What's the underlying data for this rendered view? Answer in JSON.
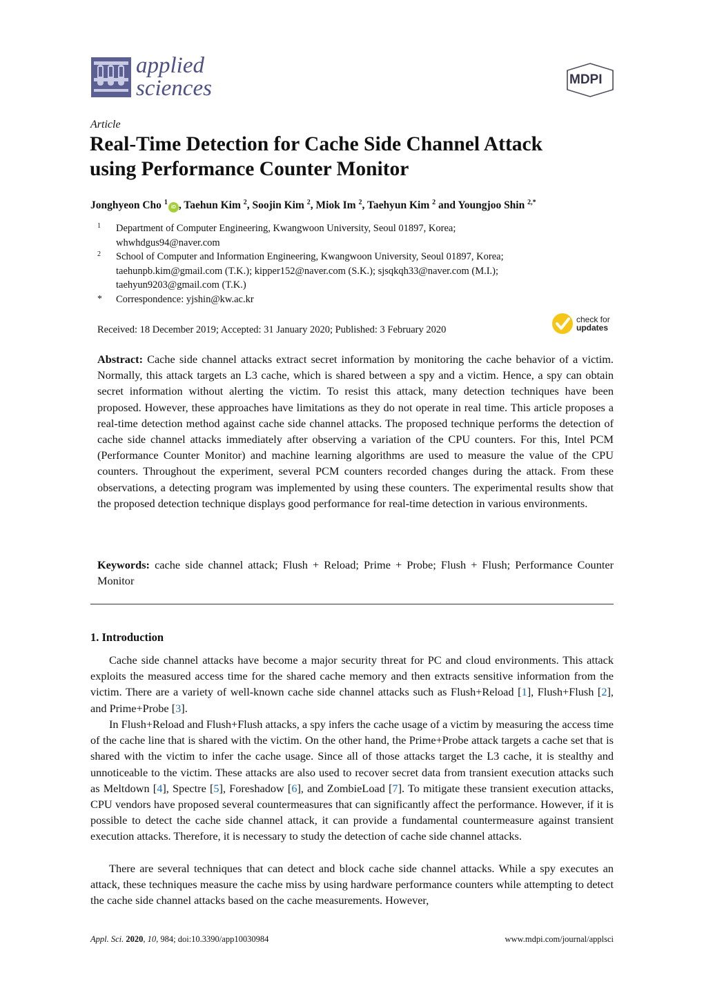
{
  "header": {
    "journal_name_line1": "applied",
    "journal_name_line2": "sciences",
    "publisher_logo": "MDPI"
  },
  "article_type": "Article",
  "title_line1": "Real-Time Detection for Cache Side Channel Attack",
  "title_line2": "using Performance Counter Monitor",
  "authors": [
    {
      "name": "Jonghyeon Cho",
      "sup": "1",
      "orcid": true
    },
    {
      "name": "Taehun Kim",
      "sup": "2"
    },
    {
      "name": "Soojin Kim",
      "sup": "2"
    },
    {
      "name": "Miok Im",
      "sup": "2"
    },
    {
      "name": "Taehyun Kim",
      "sup": "2"
    },
    {
      "name": "Youngjoo Shin",
      "sup": "2,*"
    }
  ],
  "author_separators": {
    "comma": ", ",
    "and": " and "
  },
  "orcid_label": "iD",
  "affiliations": [
    {
      "mark": "1",
      "lines": [
        "Department of Computer Engineering, Kwangwoon University, Seoul 01897, Korea;",
        "whwhdgus94@naver.com"
      ]
    },
    {
      "mark": "2",
      "lines": [
        "School of Computer and Information Engineering, Kwangwoon University, Seoul 01897, Korea;",
        "taehunpb.kim@gmail.com (T.K.); kipper152@naver.com (S.K.); sjsqkqh33@naver.com (M.I.);",
        "taehyun9203@gmail.com (T.K.)"
      ]
    },
    {
      "mark": "*",
      "lines": [
        "Correspondence: yjshin@kw.ac.kr"
      ]
    }
  ],
  "dates": "Received: 18 December 2019; Accepted: 31 January 2020; Published: 3 February 2020",
  "check_updates": {
    "line1": "check for",
    "line2": "updates",
    "color": "#f5c518"
  },
  "abstract": {
    "label": "Abstract:",
    "text": "Cache side channel attacks extract secret information by monitoring the cache behavior of a victim. Normally, this attack targets an L3 cache, which is shared between a spy and a victim. Hence, a spy can obtain secret information without alerting the victim. To resist this attack, many detection techniques have been proposed. However, these approaches have limitations as they do not operate in real time. This article proposes a real-time detection method against cache side channel attacks. The proposed technique performs the detection of cache side channel attacks immediately after observing a variation of the CPU counters. For this, Intel PCM (Performance Counter Monitor) and machine learning algorithms are used to measure the value of the CPU counters. Throughout the experiment, several PCM counters recorded changes during the attack. From these observations, a detecting program was implemented by using these counters. The experimental results show that the proposed detection technique displays good performance for real-time detection in various environments."
  },
  "keywords": {
    "label": "Keywords:",
    "text": "cache side channel attack; Flush + Reload; Prime + Probe; Flush + Flush; Performance Counter Monitor"
  },
  "section": {
    "heading": "1. Introduction",
    "p1": [
      "Cache side channel attacks have become a major security threat for PC and cloud environments. This attack exploits the measured access time for the shared cache memory and then extracts sensitive information from the victim. There are a variety of well-known cache side channel attacks such as Flush+Reload [",
      {
        "cite": "1"
      },
      "], Flush+Flush [",
      {
        "cite": "2"
      },
      "], and Prime+Probe [",
      {
        "cite": "3"
      },
      "]."
    ],
    "p2": [
      "In Flush+Reload and Flush+Flush attacks, a spy infers the cache usage of a victim by measuring the access time of the cache line that is shared with the victim. On the other hand, the Prime+Probe attack targets a cache set that is shared with the victim to infer the cache usage. Since all of those attacks target the L3 cache, it is stealthy and unnoticeable to the victim. These attacks are also used to recover secret data from transient execution attacks such as Meltdown [",
      {
        "cite": "4"
      },
      "], Spectre [",
      {
        "cite": "5"
      },
      "], Foreshadow [",
      {
        "cite": "6"
      },
      "], and ZombieLoad [",
      {
        "cite": "7"
      },
      "]. To mitigate these transient execution attacks, CPU vendors have proposed several countermeasures that can significantly affect the performance. However, if it is possible to detect the cache side channel attack, it can provide a fundamental countermeasure against transient execution attacks. Therefore, it is necessary to study the detection of cache side channel attacks."
    ],
    "p3": [
      "There are several techniques that can detect and block cache side channel attacks. While a spy executes an attack, these techniques measure the cache miss by using hardware performance counters while attempting to detect the cache side channel attacks based on the cache measurements. However,"
    ]
  },
  "footer": {
    "journal_abbrev": "Appl. Sci.",
    "year": "2020",
    "volume": "10",
    "rest": ", 984; doi:10.3390/app10030984",
    "url": "www.mdpi.com/journal/applsci"
  },
  "colors": {
    "journal": "#4d5086",
    "cite_link": "#1a6fb5",
    "orcid": "#a6ce39"
  }
}
